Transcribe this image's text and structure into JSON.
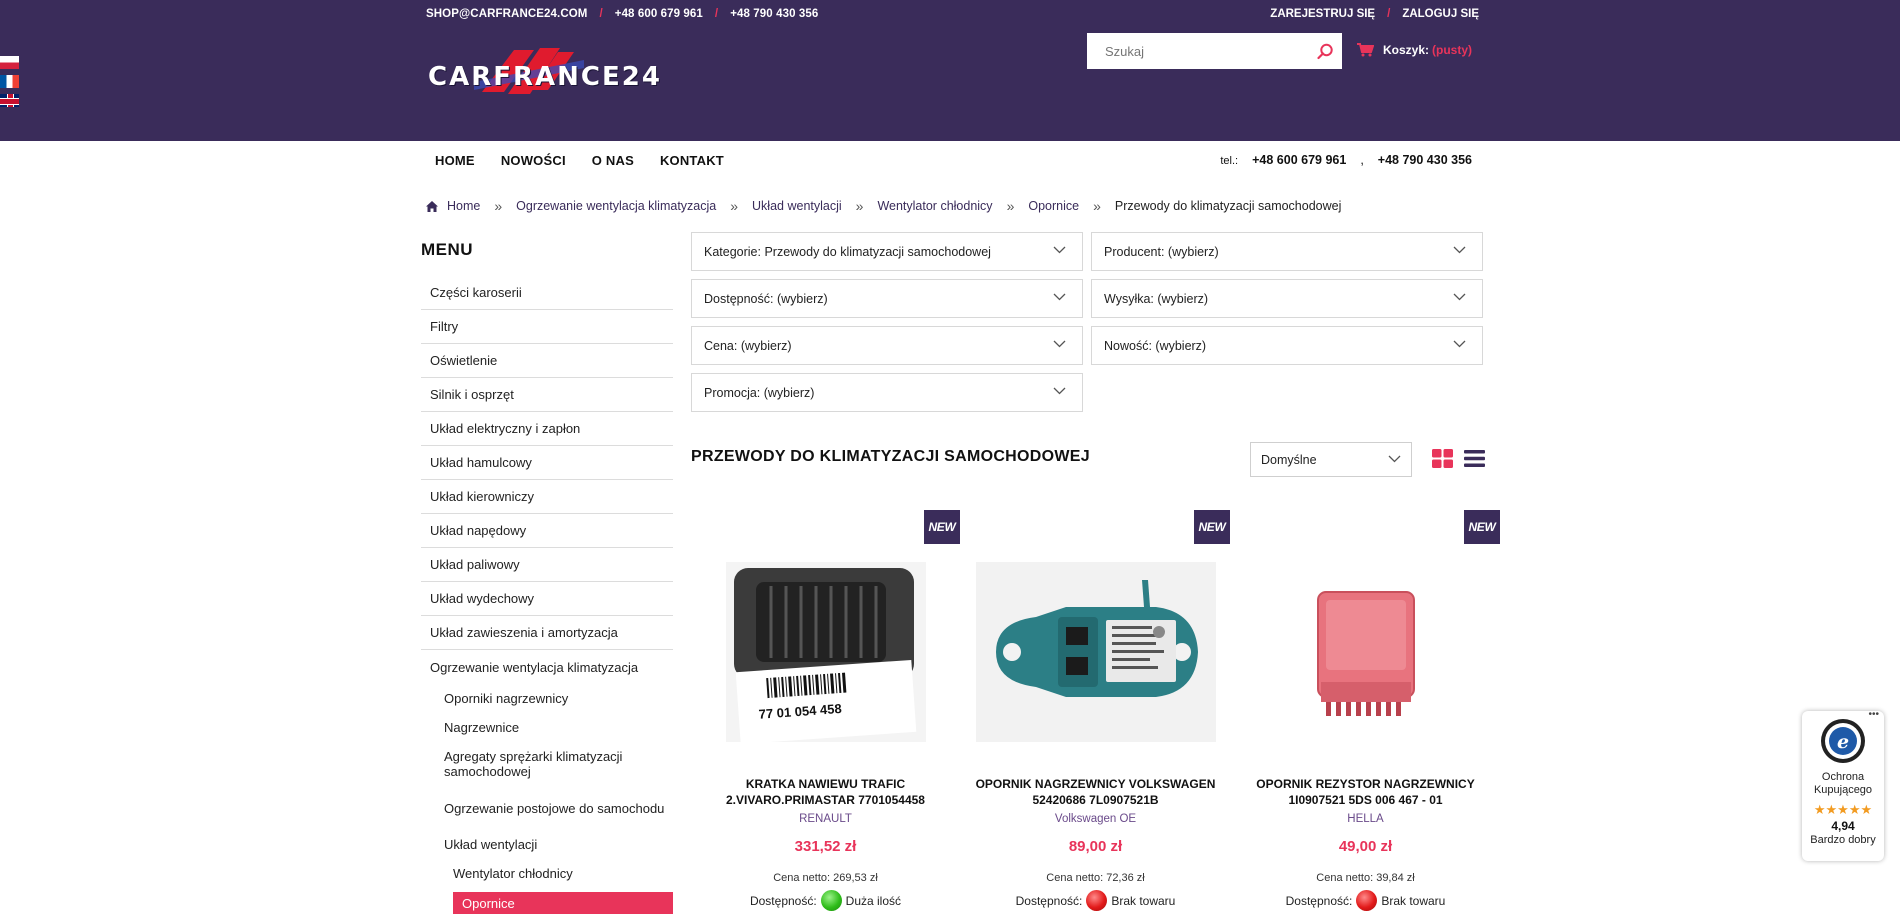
{
  "header": {
    "email": "SHOP@CARFRANCE24.COM",
    "phone1": "+48 600 679 961",
    "phone2": "+48 790 430 356",
    "register": "ZAREJESTRUJ SIĘ",
    "login": "ZALOGUJ SIĘ",
    "logo_text": "CARFRANCE24",
    "search_placeholder": "Szukaj",
    "cart_label": "Koszyk:",
    "cart_status": "(pusty)",
    "accent_color": "#e8345a",
    "brand_color": "#3a2c5a"
  },
  "nav": {
    "items": [
      "HOME",
      "NOWOŚCI",
      "O NAS",
      "KONTAKT"
    ],
    "tel_label": "tel.:",
    "phone1": "+48 600 679 961",
    "sep": ",",
    "phone2": "+48 790 430 356"
  },
  "breadcrumb": {
    "items": [
      "Home",
      "Ogrzewanie wentylacja klimatyzacja",
      "Układ wentylacji",
      "Wentylator chłodnicy",
      "Opornice",
      "Przewody do klimatyzacji samochodowej"
    ]
  },
  "sidebar": {
    "title": "MENU",
    "items": [
      "Części karoserii",
      "Filtry",
      "Oświetlenie",
      "Silnik i osprzęt",
      "Układ elektryczny i zapłon",
      "Układ hamulcowy",
      "Układ kierowniczy",
      "Układ napędowy",
      "Układ paliwowy",
      "Układ wydechowy",
      "Układ zawieszenia i amortyzacja",
      "Ogrzewanie wentylacja klimatyzacja"
    ],
    "sub_items": [
      "Oporniki nagrzewnicy",
      "Nagrzewnice",
      "Agregaty sprężarki klimatyzacji samochodowej",
      "Ogrzewanie postojowe do samochodu",
      "Układ wentylacji"
    ],
    "sub_sub_items": [
      "Wentylator chłodnicy"
    ],
    "active": "Opornice"
  },
  "filters": [
    "Kategorie: Przewody do klimatyzacji samochodowej",
    "Producent: (wybierz)",
    "Dostępność: (wybierz)",
    "Wysyłka: (wybierz)",
    "Cena: (wybierz)",
    "Nowość: (wybierz)",
    "Promocja: (wybierz)"
  ],
  "listing": {
    "title": "PRZEWODY DO KLIMATYZACJI SAMOCHODOWEJ",
    "sort_value": "Domyślne"
  },
  "products": [
    {
      "badge": "NEW",
      "name": "KRATKA NAWIEWU TRAFIC 2.VIVARO.PRIMASTAR 7701054458",
      "brand": "RENAULT",
      "price": "331,52 zł",
      "netto": "Cena netto: 269,53 zł",
      "avail_label": "Dostępność:",
      "avail": "Duża ilość",
      "status": "green",
      "barcode": "77 01 054 458"
    },
    {
      "badge": "NEW",
      "name": "OPORNIK NAGRZEWNICY VOLKSWAGEN 52420686 7L0907521B",
      "brand": "Volkswagen OE",
      "price": "89,00 zł",
      "netto": "Cena netto: 72,36 zł",
      "avail_label": "Dostępność:",
      "avail": "Brak towaru",
      "status": "red"
    },
    {
      "badge": "NEW",
      "name": "OPORNIK REZYSTOR NAGRZEWNICY 1I0907521 5DS 006 467 - 01",
      "brand": "HELLA",
      "price": "49,00 zł",
      "netto": "Cena netto: 39,84 zł",
      "avail_label": "Dostępność:",
      "avail": "Brak towaru",
      "status": "red"
    }
  ],
  "trust_badge": {
    "label": "Ochrona Kupującego",
    "stars": "★★★★★",
    "score": "4,94",
    "verdict": "Bardzo dobry"
  }
}
